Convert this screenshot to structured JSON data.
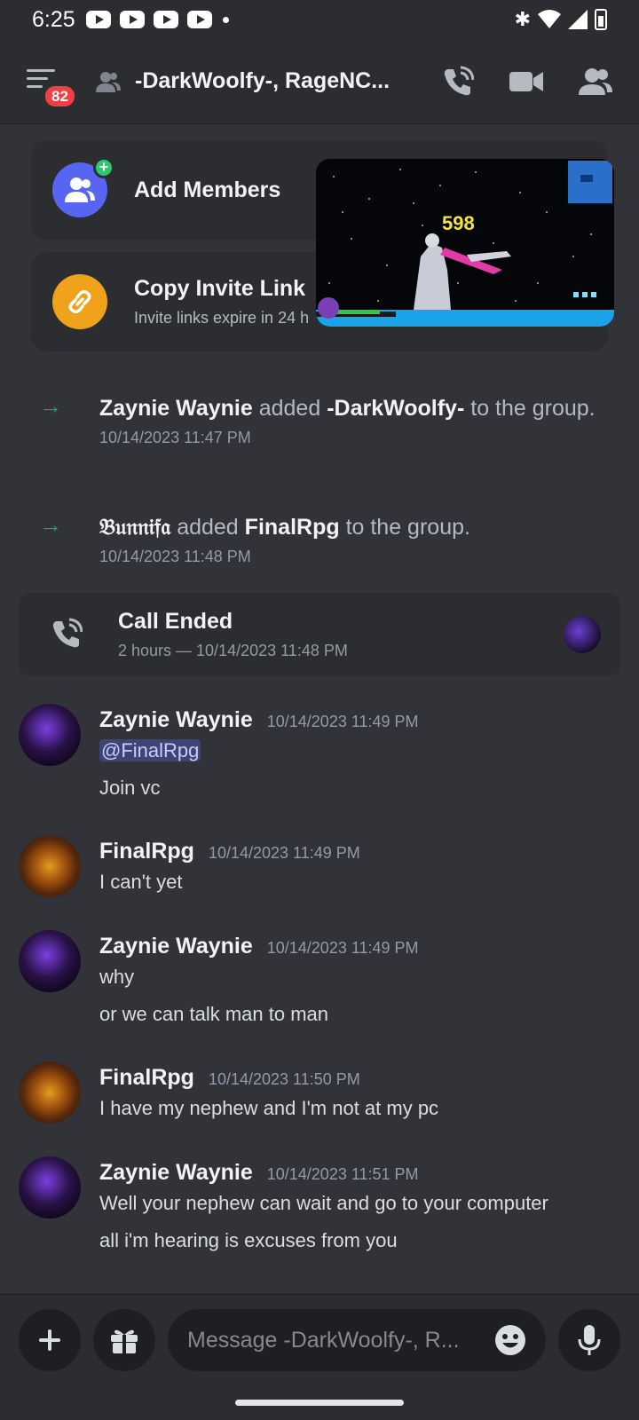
{
  "status_bar": {
    "time": "6:25"
  },
  "header": {
    "title": "-DarkWoolfy-, RageNC...",
    "badge_count": "82"
  },
  "invite": {
    "add_members": "Add Members",
    "copy_link": "Copy Invite Link",
    "copy_link_sub": "Invite links expire in 24 h"
  },
  "pip": {
    "score": "598"
  },
  "system_messages": [
    {
      "actor": "Zaynie Waynie",
      "verb": "added",
      "target": "-DarkWoolfy-",
      "suffix": "to the group.",
      "time": "10/14/2023 11:47 PM"
    },
    {
      "actor": "𝔅𝔲𝔫𝔫𝔦𝔣𝔞",
      "verb": "added",
      "target": "FinalRpg",
      "suffix": "to the group.",
      "time": "10/14/2023 11:48 PM"
    }
  ],
  "call": {
    "title": "Call Ended",
    "sub": "2 hours — 10/14/2023 11:48 PM"
  },
  "messages": [
    {
      "author": "Zaynie Waynie",
      "time": "10/14/2023 11:49 PM",
      "mention": "@FinalRpg",
      "lines": [
        "Join vc"
      ]
    },
    {
      "author": "FinalRpg",
      "time": "10/14/2023 11:49 PM",
      "lines": [
        "I can't yet"
      ]
    },
    {
      "author": "Zaynie Waynie",
      "time": "10/14/2023 11:49 PM",
      "lines": [
        "why",
        "or we can talk man to man"
      ]
    },
    {
      "author": "FinalRpg",
      "time": "10/14/2023 11:50 PM",
      "lines": [
        "I have my nephew and I'm not at my pc"
      ]
    },
    {
      "author": "Zaynie Waynie",
      "time": "10/14/2023 11:51 PM",
      "lines": [
        "Well your nephew can wait and go to your computer",
        "all i'm hearing is excuses from you"
      ]
    }
  ],
  "composer": {
    "placeholder": "Message -DarkWoolfy-, R..."
  },
  "colors": {
    "accent": "#5865f2",
    "green": "#23a55a",
    "orange": "#f0a21b",
    "badge": "#f23f42"
  },
  "icons": [
    "hamburger-icon",
    "group-icon",
    "phone-call-icon",
    "video-icon",
    "members-icon",
    "add-members-icon",
    "link-icon",
    "arrow-right-icon",
    "call-ended-icon",
    "plus-icon",
    "gift-icon",
    "emoji-icon",
    "mic-icon"
  ]
}
